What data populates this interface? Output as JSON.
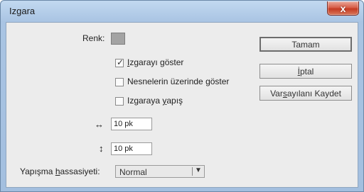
{
  "window": {
    "title": "Izgara",
    "close_glyph": "x"
  },
  "form": {
    "color_label": "Renk:",
    "checkboxes": [
      {
        "prefix": "",
        "accel": "I",
        "rest": "zgarayı göster",
        "checked": true
      },
      {
        "text": "Nesnelerin üzerinde göster",
        "checked": false
      },
      {
        "prefix": "Izgaraya ",
        "accel": "y",
        "rest": "apış",
        "checked": false
      }
    ],
    "horizontal_spacing": {
      "icon": "horizontal-arrows-icon",
      "value": "10 pk"
    },
    "vertical_spacing": {
      "icon": "vertical-arrows-icon",
      "value": "10 pk"
    },
    "snap_sensitivity": {
      "prefix": "Yapışma ",
      "accel": "h",
      "rest": "assasiyeti:",
      "value": "Normal"
    }
  },
  "buttons": {
    "ok": "Tamam",
    "cancel_accel": "İ",
    "cancel_rest": "ptal",
    "save_defaults_prefix": "Var",
    "save_defaults_accel": "s",
    "save_defaults_rest": "ayılanı Kaydet"
  },
  "colors": {
    "title_bg": "#b6cfea",
    "client_bg": "#ececec",
    "swatch": "#a3a3a3",
    "close": "#c43b22"
  }
}
